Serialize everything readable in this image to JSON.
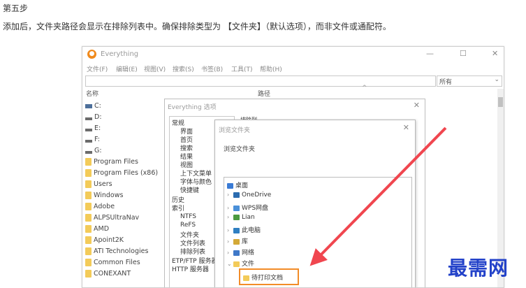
{
  "article": {
    "step_heading": "第五步",
    "description": "添加后，文件夹路径会显示在排除列表中。确保排除类型为 【文件夹】（默认选项），而非文件或通配符。"
  },
  "everything_window": {
    "title": "Everything",
    "menu": [
      "文件(F)",
      "编辑(E)",
      "视图(V)",
      "搜索(S)",
      "书签(B)",
      "工具(T)",
      "帮助(H)"
    ],
    "filter_value": "所有",
    "columns": {
      "name": "名称",
      "path": "路径"
    },
    "items": [
      {
        "label": "C:",
        "icon": "system-drive-icon"
      },
      {
        "label": "D:",
        "icon": "drive-icon"
      },
      {
        "label": "E:",
        "icon": "drive-icon"
      },
      {
        "label": "F:",
        "icon": "drive-icon"
      },
      {
        "label": "G:",
        "icon": "drive-icon"
      },
      {
        "label": "Program Files",
        "icon": "folder-icon"
      },
      {
        "label": "Program Files (x86)",
        "icon": "folder-icon"
      },
      {
        "label": "Users",
        "icon": "folder-icon"
      },
      {
        "label": "Windows",
        "icon": "folder-icon"
      },
      {
        "label": "Adobe",
        "icon": "folder-icon"
      },
      {
        "label": "ALPSUltraNav",
        "icon": "folder-icon"
      },
      {
        "label": "AMD",
        "icon": "folder-icon"
      },
      {
        "label": "Apoint2K",
        "icon": "folder-icon"
      },
      {
        "label": "ATI Technologies",
        "icon": "folder-icon"
      },
      {
        "label": "Common Files",
        "icon": "folder-icon"
      },
      {
        "label": "CONEXANT",
        "icon": "folder-icon"
      }
    ]
  },
  "options_dialog": {
    "title": "Everything 选项",
    "tab_fragment": "排除列",
    "tree": [
      "常规",
      "界面",
      "首页",
      "搜索",
      "结果",
      "视图",
      "上下文菜单",
      "字体与颜色",
      "快捷键",
      "历史",
      "索引",
      "NTFS",
      "ReFS",
      "文件夹",
      "文件列表",
      "排除列表",
      "ETP/FTP 服务器",
      "HTTP 服务器"
    ]
  },
  "browse_dialog": {
    "title": "浏览文件夹",
    "label": "浏览文件夹",
    "items": [
      {
        "label": "桌面",
        "icon": "desktop-icon",
        "color": "#3a7bd5"
      },
      {
        "label": "OneDrive",
        "icon": "onedrive-icon",
        "color": "#2b6cb0"
      },
      {
        "label": "WPS网盘",
        "icon": "wps-cloud-icon",
        "color": "#4a90d9"
      },
      {
        "label": "Lian",
        "icon": "user-icon",
        "color": "#4c9a3f"
      },
      {
        "label": "此电脑",
        "icon": "computer-icon",
        "color": "#2f7fc1"
      },
      {
        "label": "库",
        "icon": "library-icon",
        "color": "#d4a937"
      },
      {
        "label": "网络",
        "icon": "network-icon",
        "color": "#3f78c8"
      },
      {
        "label": "文件",
        "icon": "folder-icon",
        "color": "#f3cb59"
      },
      {
        "label": "待打印文档",
        "icon": "folder-icon",
        "color": "#f3cb59"
      }
    ]
  },
  "watermark": {
    "text": "最需网",
    "color": "#2342c9"
  },
  "colors": {
    "annotation_arrow": "#f0464f",
    "highlight_border": "#f28c28"
  }
}
